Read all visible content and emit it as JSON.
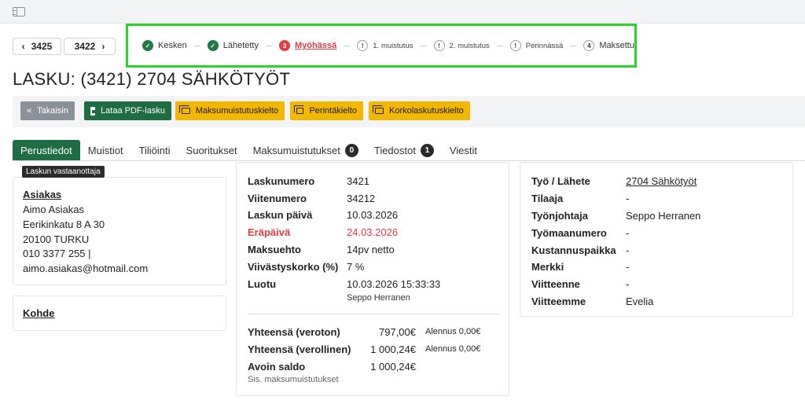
{
  "topbar": {
    "menu_icon": "sidebar-toggle-icon"
  },
  "nav": {
    "prev_label": "3425",
    "next_label": "3422"
  },
  "steps": [
    {
      "label": "Kesken",
      "icon": "✓",
      "state": "done"
    },
    {
      "label": "Lähetetty",
      "icon": "✓",
      "state": "done"
    },
    {
      "label": "Myöhässä",
      "icon": "3",
      "state": "late"
    },
    {
      "label": "1. muistutus",
      "icon": "!",
      "state": "warn"
    },
    {
      "label": "2. muistutus",
      "icon": "!",
      "state": "warn"
    },
    {
      "label": "Perinnässä",
      "icon": "!",
      "state": "warn"
    },
    {
      "label": "Maksettu",
      "icon": "4",
      "state": "pending"
    }
  ],
  "page": {
    "title": "LASKU: (3421) 2704 SÄHKÖTYÖT"
  },
  "actions": {
    "back": "Takaisin",
    "pdf": "Lataa PDF-lasku",
    "reminder_ban": "Maksumuistutuskielto",
    "collection_ban": "Perintäkielto",
    "interest_ban": "Korkolaskutuskielto"
  },
  "tabs": [
    {
      "label": "Perustiedot"
    },
    {
      "label": "Muistiot"
    },
    {
      "label": "Tiliöinti"
    },
    {
      "label": "Suoritukset"
    },
    {
      "label": "Maksumuistutukset",
      "badge": "0"
    },
    {
      "label": "Tiedostot",
      "badge": "1"
    },
    {
      "label": "Viestit"
    }
  ],
  "recipient": {
    "section_label": "Laskun vastaanottaja",
    "heading": "Asiakas",
    "name": "Aimo Asiakas",
    "street": "Eerikinkatu 8 A 30",
    "city": "20100 TURKU",
    "phone": "010 3377 255 |",
    "email": "aimo.asiakas@hotmail.com",
    "target_heading": "Kohde"
  },
  "invoice": {
    "fields": [
      {
        "key": "Laskunumero",
        "value": "3421"
      },
      {
        "key": "Viitenumero",
        "value": "34212"
      },
      {
        "key": "Laskun päivä",
        "value": "10.03.2026"
      },
      {
        "key": "Eräpäivä",
        "value": "24.03.2026"
      },
      {
        "key": "Maksuehto",
        "value": "14pv netto"
      },
      {
        "key": "Viivästyskorko (%)",
        "value": "7 %"
      },
      {
        "key": "Luotu",
        "value": "10.03.2026 15:33:33"
      }
    ],
    "created_by": "Seppo Herranen",
    "totals": [
      {
        "key": "Yhteensä (veroton)",
        "value": "797,00€",
        "discount": "Alennus 0,00€"
      },
      {
        "key": "Yhteensä (verollinen)",
        "value": "1 000,24€",
        "discount": "Alennus 0,00€"
      },
      {
        "key": "Avoin saldo",
        "value": "1 000,24€"
      }
    ],
    "note": "Sis. maksumuistutukset"
  },
  "job": {
    "fields": [
      {
        "key": "Työ / Lähete",
        "value": "2704 Sähkötyöt"
      },
      {
        "key": "Tilaaja",
        "value": "-"
      },
      {
        "key": "Työnjohtaja",
        "value": "Seppo Herranen"
      },
      {
        "key": "Työmaanumero",
        "value": "-"
      },
      {
        "key": "Kustannuspaikka",
        "value": "-"
      },
      {
        "key": "Merkki",
        "value": "-"
      },
      {
        "key": "Viitteenne",
        "value": "-"
      },
      {
        "key": "Viitteemme",
        "value": "Evelia"
      }
    ]
  },
  "colors": {
    "primary": "#1f6e43",
    "warning": "#f3b700",
    "danger": "#e23c45",
    "highlight": "#2bd62b"
  }
}
